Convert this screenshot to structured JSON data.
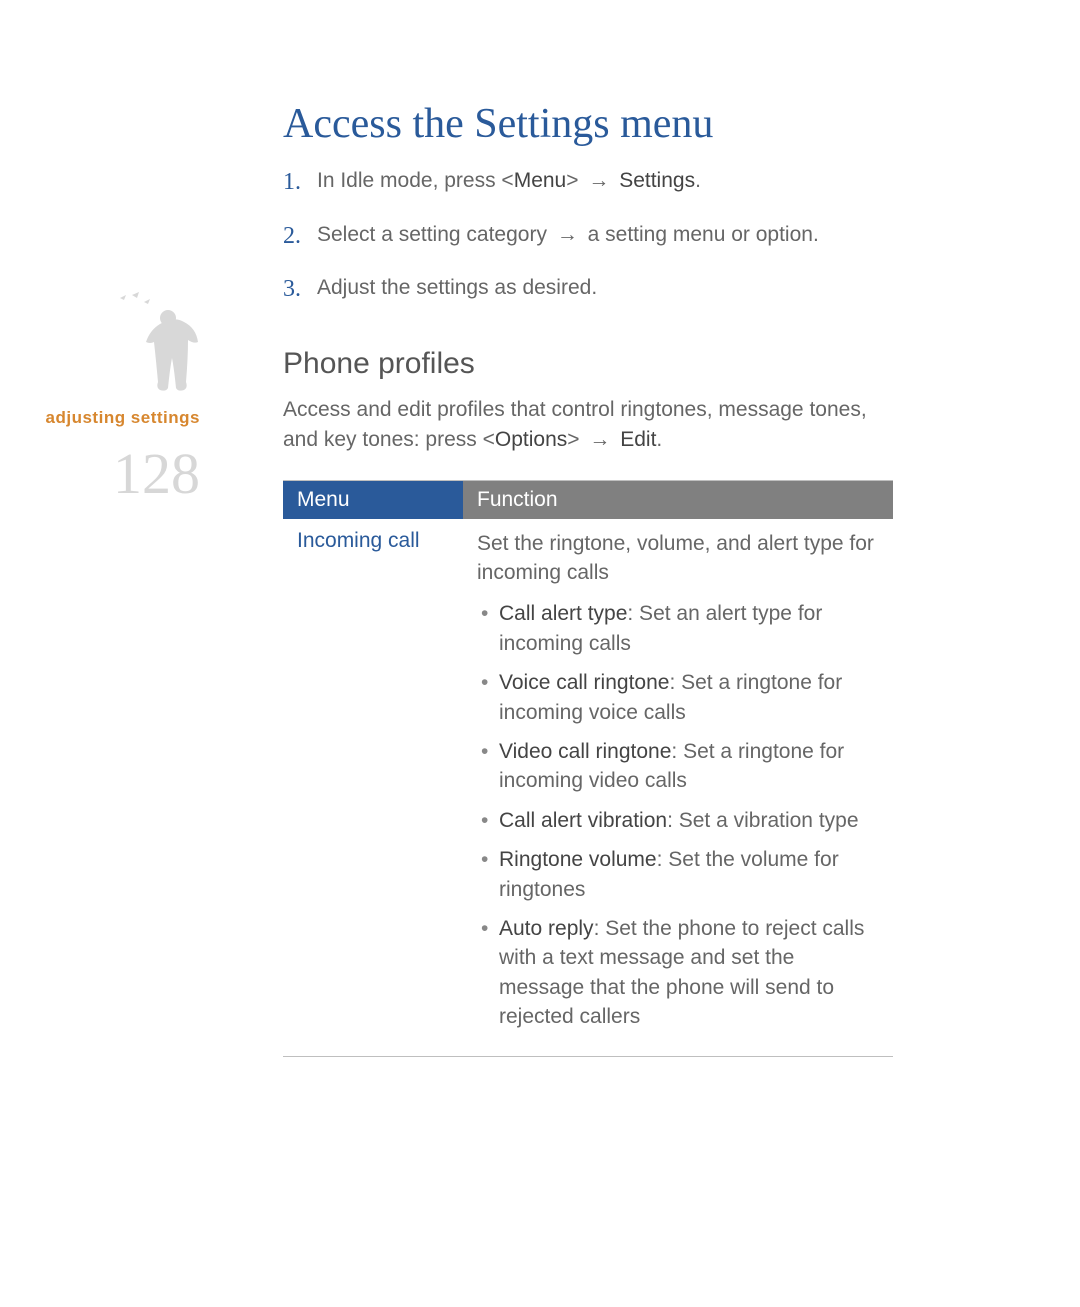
{
  "sidebar": {
    "label": "adjusting settings",
    "page_number": "128"
  },
  "title": "Access the Settings menu",
  "steps": [
    {
      "num": "1.",
      "pre": "In Idle mode, press <",
      "bold1": "Menu",
      "mid": "> ",
      "arrow": "→",
      "post_pre": " ",
      "bold2": "Settings",
      "post": "."
    },
    {
      "num": "2.",
      "pre": "Select a setting category ",
      "arrow": "→",
      "post": " a setting menu or option."
    },
    {
      "num": "3.",
      "text": "Adjust the settings as desired."
    }
  ],
  "section": {
    "heading": "Phone profiles",
    "intro_pre": "Access and edit profiles that control ringtones, message tones, and key tones: press <",
    "intro_bold1": "Options",
    "intro_mid": "> ",
    "intro_arrow": "→",
    "intro_post_pre": " ",
    "intro_bold2": "Edit",
    "intro_post": "."
  },
  "table": {
    "headers": {
      "menu": "Menu",
      "function": "Function"
    },
    "row": {
      "menu": "Incoming call",
      "summary": "Set the ringtone, volume, and alert type for incoming calls",
      "bullets": [
        {
          "bold": "Call alert type",
          "text": ": Set an alert type for incoming calls"
        },
        {
          "bold": "Voice call ringtone",
          "text": ": Set a ringtone for incoming voice calls"
        },
        {
          "bold": "Video call ringtone",
          "text": ": Set a ringtone for incoming video calls"
        },
        {
          "bold": "Call alert vibration",
          "text": ": Set a vibration type"
        },
        {
          "bold": "Ringtone volume",
          "text": ": Set the volume for ringtones"
        },
        {
          "bold": "Auto reply",
          "text": ": Set the phone to reject calls with a text message and set the message that the phone will send to rejected callers"
        }
      ]
    }
  }
}
